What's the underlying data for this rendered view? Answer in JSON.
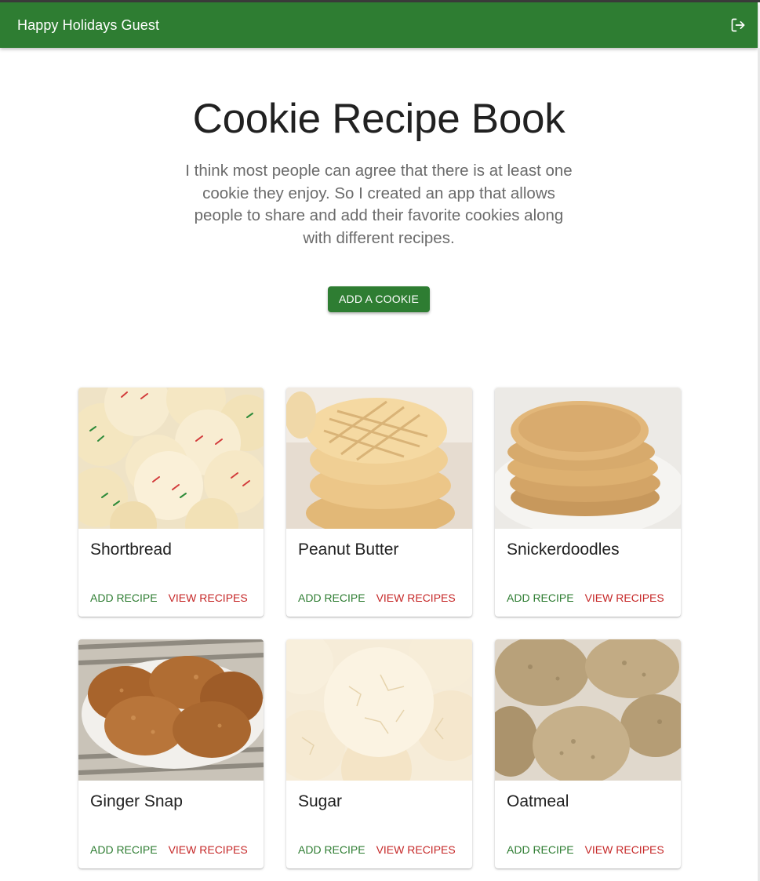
{
  "appbar": {
    "title": "Happy Holidays Guest",
    "logout_icon": "logout-icon",
    "color": "#2e7d32"
  },
  "hero": {
    "title": "Cookie Recipe Book",
    "description": "I think most people can agree that there is at least one cookie they enjoy. So I created an app that allows people to share and add their favorite cookies along with different recipes.",
    "cta_label": "ADD A COOKIE"
  },
  "cards": [
    {
      "name": "Shortbread",
      "add_label": "ADD RECIPE",
      "view_label": "VIEW RECIPES"
    },
    {
      "name": "Peanut Butter",
      "add_label": "ADD RECIPE",
      "view_label": "VIEW RECIPES"
    },
    {
      "name": "Snickerdoodles",
      "add_label": "ADD RECIPE",
      "view_label": "VIEW RECIPES"
    },
    {
      "name": "Ginger Snap",
      "add_label": "ADD RECIPE",
      "view_label": "VIEW RECIPES"
    },
    {
      "name": "Sugar",
      "add_label": "ADD RECIPE",
      "view_label": "VIEW RECIPES"
    },
    {
      "name": "Oatmeal",
      "add_label": "ADD RECIPE",
      "view_label": "VIEW RECIPES"
    }
  ],
  "colors": {
    "primary": "#2e7d32",
    "secondary": "#c62828"
  }
}
